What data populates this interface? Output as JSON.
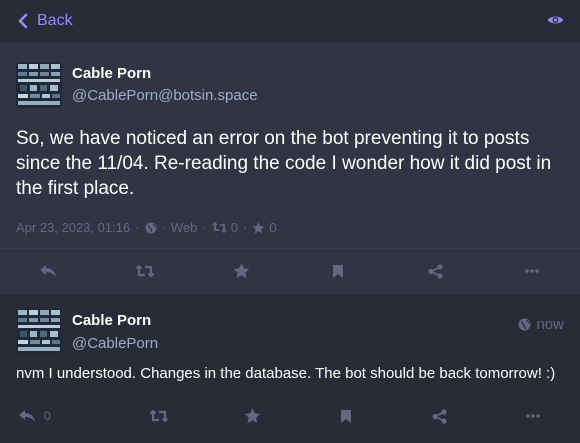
{
  "header": {
    "back_label": "Back",
    "back_icon": "chevron-left-icon",
    "visibility_icon": "eye-icon"
  },
  "main_status": {
    "display_name": "Cable Porn",
    "acct": "@CablePorn@botsin.space",
    "content": "So, we have noticed an error on the bot preventing it to posts since the 11/04. Re-reading the code I wonder how it did post in the first place.",
    "timestamp": "Apr 23, 2023, 01:16",
    "application": "Web",
    "boost_count": "0",
    "favourite_count": "0"
  },
  "reply_status": {
    "display_name": "Cable Porn",
    "acct": "@CablePorn",
    "time": "now",
    "content": "nvm I understood. Changes in the database. The bot should be back tomorrow! :)",
    "reply_count": "0"
  },
  "colors": {
    "accent": "#8c8dff",
    "background": "#282c37",
    "panel": "#313543",
    "muted": "#606984",
    "secondary_text": "#9baec8"
  }
}
